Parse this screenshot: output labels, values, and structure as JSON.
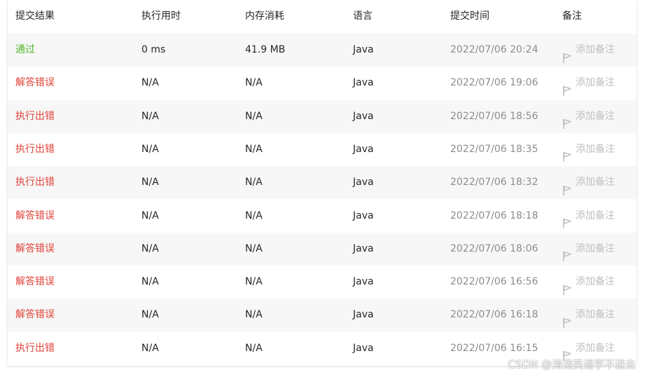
{
  "header": {
    "result": "提交结果",
    "runtime": "执行用时",
    "memory": "内存消耗",
    "language": "语言",
    "submit_time": "提交时间",
    "note": "备注"
  },
  "colors": {
    "pass": "#52b52b",
    "fail": "#e0433a",
    "muted": "#bfbfbf",
    "time": "#8c8c8c"
  },
  "rows": [
    {
      "status": "通过",
      "status_type": "pass",
      "runtime": "0 ms",
      "memory": "41.9 MB",
      "language": "Java",
      "time": "2022/07/06 20:24",
      "note": "添加备注"
    },
    {
      "status": "解答错误",
      "status_type": "fail",
      "runtime": "N/A",
      "memory": "N/A",
      "language": "Java",
      "time": "2022/07/06 19:06",
      "note": "添加备注"
    },
    {
      "status": "执行出错",
      "status_type": "fail",
      "runtime": "N/A",
      "memory": "N/A",
      "language": "Java",
      "time": "2022/07/06 18:56",
      "note": "添加备注"
    },
    {
      "status": "执行出错",
      "status_type": "fail",
      "runtime": "N/A",
      "memory": "N/A",
      "language": "Java",
      "time": "2022/07/06 18:35",
      "note": "添加备注"
    },
    {
      "status": "执行出错",
      "status_type": "fail",
      "runtime": "N/A",
      "memory": "N/A",
      "language": "Java",
      "time": "2022/07/06 18:32",
      "note": "添加备注"
    },
    {
      "status": "解答错误",
      "status_type": "fail",
      "runtime": "N/A",
      "memory": "N/A",
      "language": "Java",
      "time": "2022/07/06 18:18",
      "note": "添加备注"
    },
    {
      "status": "解答错误",
      "status_type": "fail",
      "runtime": "N/A",
      "memory": "N/A",
      "language": "Java",
      "time": "2022/07/06 18:06",
      "note": "添加备注"
    },
    {
      "status": "解答错误",
      "status_type": "fail",
      "runtime": "N/A",
      "memory": "N/A",
      "language": "Java",
      "time": "2022/07/06 16:56",
      "note": "添加备注"
    },
    {
      "status": "解答错误",
      "status_type": "fail",
      "runtime": "N/A",
      "memory": "N/A",
      "language": "Java",
      "time": "2022/07/06 16:18",
      "note": "添加备注"
    },
    {
      "status": "执行出错",
      "status_type": "fail",
      "runtime": "N/A",
      "memory": "N/A",
      "language": "Java",
      "time": "2022/07/06 16:15",
      "note": "添加备注"
    }
  ],
  "watermark": "CSDN @涛涛英语学不进去"
}
